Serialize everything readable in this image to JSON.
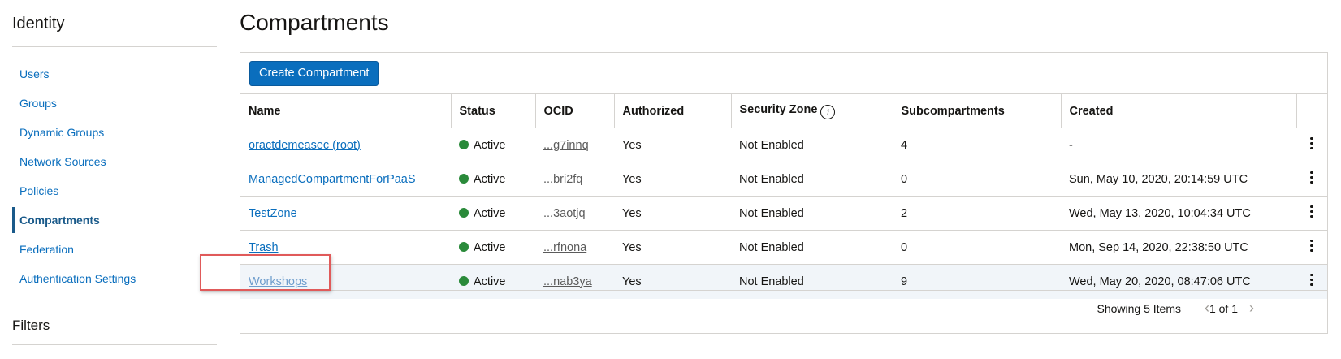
{
  "sidebar": {
    "title": "Identity",
    "items": [
      {
        "label": "Users"
      },
      {
        "label": "Groups"
      },
      {
        "label": "Dynamic Groups"
      },
      {
        "label": "Network Sources"
      },
      {
        "label": "Policies"
      },
      {
        "label": "Compartments",
        "active": true
      },
      {
        "label": "Federation"
      },
      {
        "label": "Authentication Settings"
      }
    ],
    "filters_title": "Filters"
  },
  "main": {
    "title": "Compartments",
    "create_button": "Create Compartment",
    "columns": [
      "Name",
      "Status",
      "OCID",
      "Authorized",
      "Security Zone",
      "Subcompartments",
      "Created"
    ],
    "rows": [
      {
        "name": "oractdemeasec (root)",
        "status": "Active",
        "ocid": "...g7innq",
        "authorized": "Yes",
        "security_zone": "Not Enabled",
        "subcompartments": "4",
        "created": "-"
      },
      {
        "name": "ManagedCompartmentForPaaS",
        "status": "Active",
        "ocid": "...bri2fq",
        "authorized": "Yes",
        "security_zone": "Not Enabled",
        "subcompartments": "0",
        "created": "Sun, May 10, 2020, 20:14:59 UTC"
      },
      {
        "name": "TestZone",
        "status": "Active",
        "ocid": "...3aotjq",
        "authorized": "Yes",
        "security_zone": "Not Enabled",
        "subcompartments": "2",
        "created": "Wed, May 13, 2020, 10:04:34 UTC"
      },
      {
        "name": "Trash",
        "status": "Active",
        "ocid": "...rfnona",
        "authorized": "Yes",
        "security_zone": "Not Enabled",
        "subcompartments": "0",
        "created": "Mon, Sep 14, 2020, 22:38:50 UTC"
      },
      {
        "name": "Workshops",
        "status": "Active",
        "ocid": "...nab3ya",
        "authorized": "Yes",
        "security_zone": "Not Enabled",
        "subcompartments": "9",
        "created": "Wed, May 20, 2020, 08:47:06 UTC"
      }
    ],
    "footer": {
      "showing": "Showing 5 Items",
      "pager": "1 of 1"
    }
  },
  "icons": {
    "info": "info-icon",
    "status": "status-dot-icon",
    "menu": "kebab-menu-icon",
    "prev": "chevron-left-icon",
    "next": "chevron-right-icon"
  },
  "colors": {
    "accent": "#0a6ebd",
    "active_status": "#2a8a3a",
    "highlight_box": "#e05a5a"
  }
}
